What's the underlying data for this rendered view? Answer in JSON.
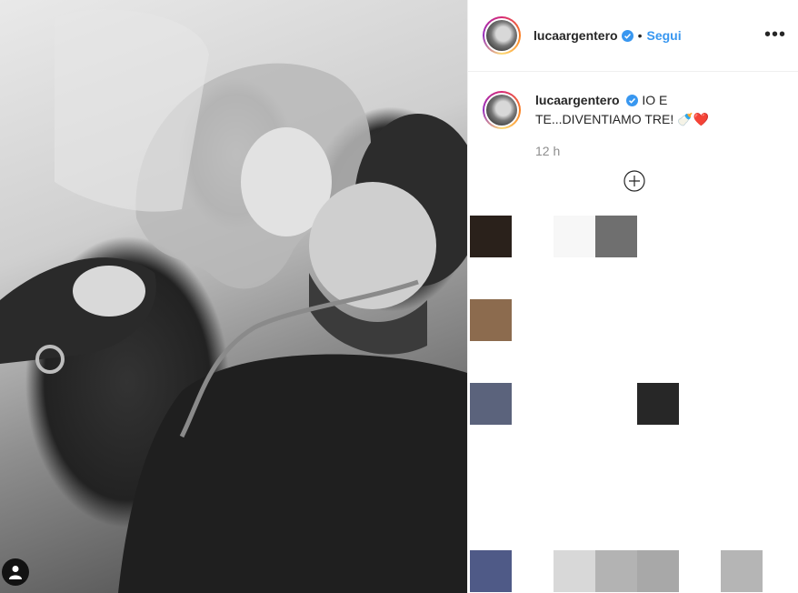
{
  "post": {
    "username": "luca​argentero",
    "follow_label": "Segui",
    "separator": "•",
    "more_label": "•••",
    "caption_username": "lucaargentero",
    "caption_text": "IO E TE...DIVENTIAMO TRE! 🍼❤️",
    "time": "12 h"
  },
  "colors": {
    "follow": "#3897f0",
    "verified": "#3897f0"
  },
  "icons": {
    "user_tag": "user-tag-icon",
    "verified": "verified-badge-icon",
    "add": "add-comment-icon",
    "more": "more-options-icon"
  }
}
